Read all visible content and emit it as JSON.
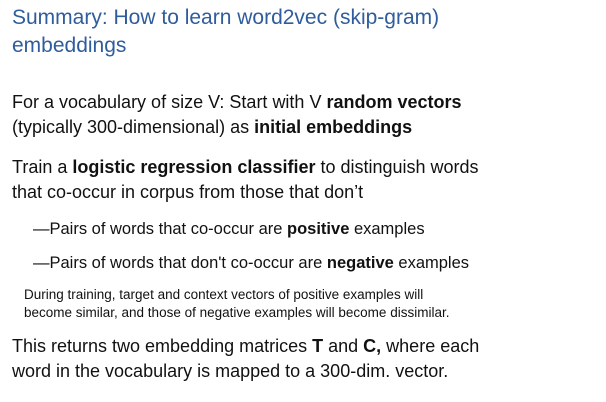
{
  "title": {
    "line1": "Summary: How to learn word2vec (skip-gram)",
    "line2": "embeddings"
  },
  "para1": {
    "line1_a": "For a vocabulary of size V: Start with V ",
    "line1_bold": "random vectors",
    "line2_a": "(typically 300-dimensional) as ",
    "line2_bold": "initial embeddings"
  },
  "para2": {
    "line1_a": "Train a ",
    "line1_bold": "logistic regression classifier",
    "line1_b": " to distinguish words",
    "line2": "that co-occur in corpus from those that don’t"
  },
  "bullets": [
    {
      "marker": "—",
      "text_a": "Pairs of words that co-occur are ",
      "bold": "positive",
      "text_b": " examples"
    },
    {
      "marker": "—",
      "text_a": "Pairs of words that don't co-occur are ",
      "bold": "negative",
      "text_b": " examples"
    }
  ],
  "note": {
    "line1": "During training, target and context vectors of positive examples will",
    "line2": "become similar, and those of negative examples will become dissimilar."
  },
  "para3": {
    "line1_a": "This returns two embedding matrices ",
    "line1_bold1": "T",
    "line1_b": " and ",
    "line1_bold2": "C,",
    "line1_c": " where each",
    "line2": "word in the vocabulary is mapped to a 300-dim. vector."
  }
}
